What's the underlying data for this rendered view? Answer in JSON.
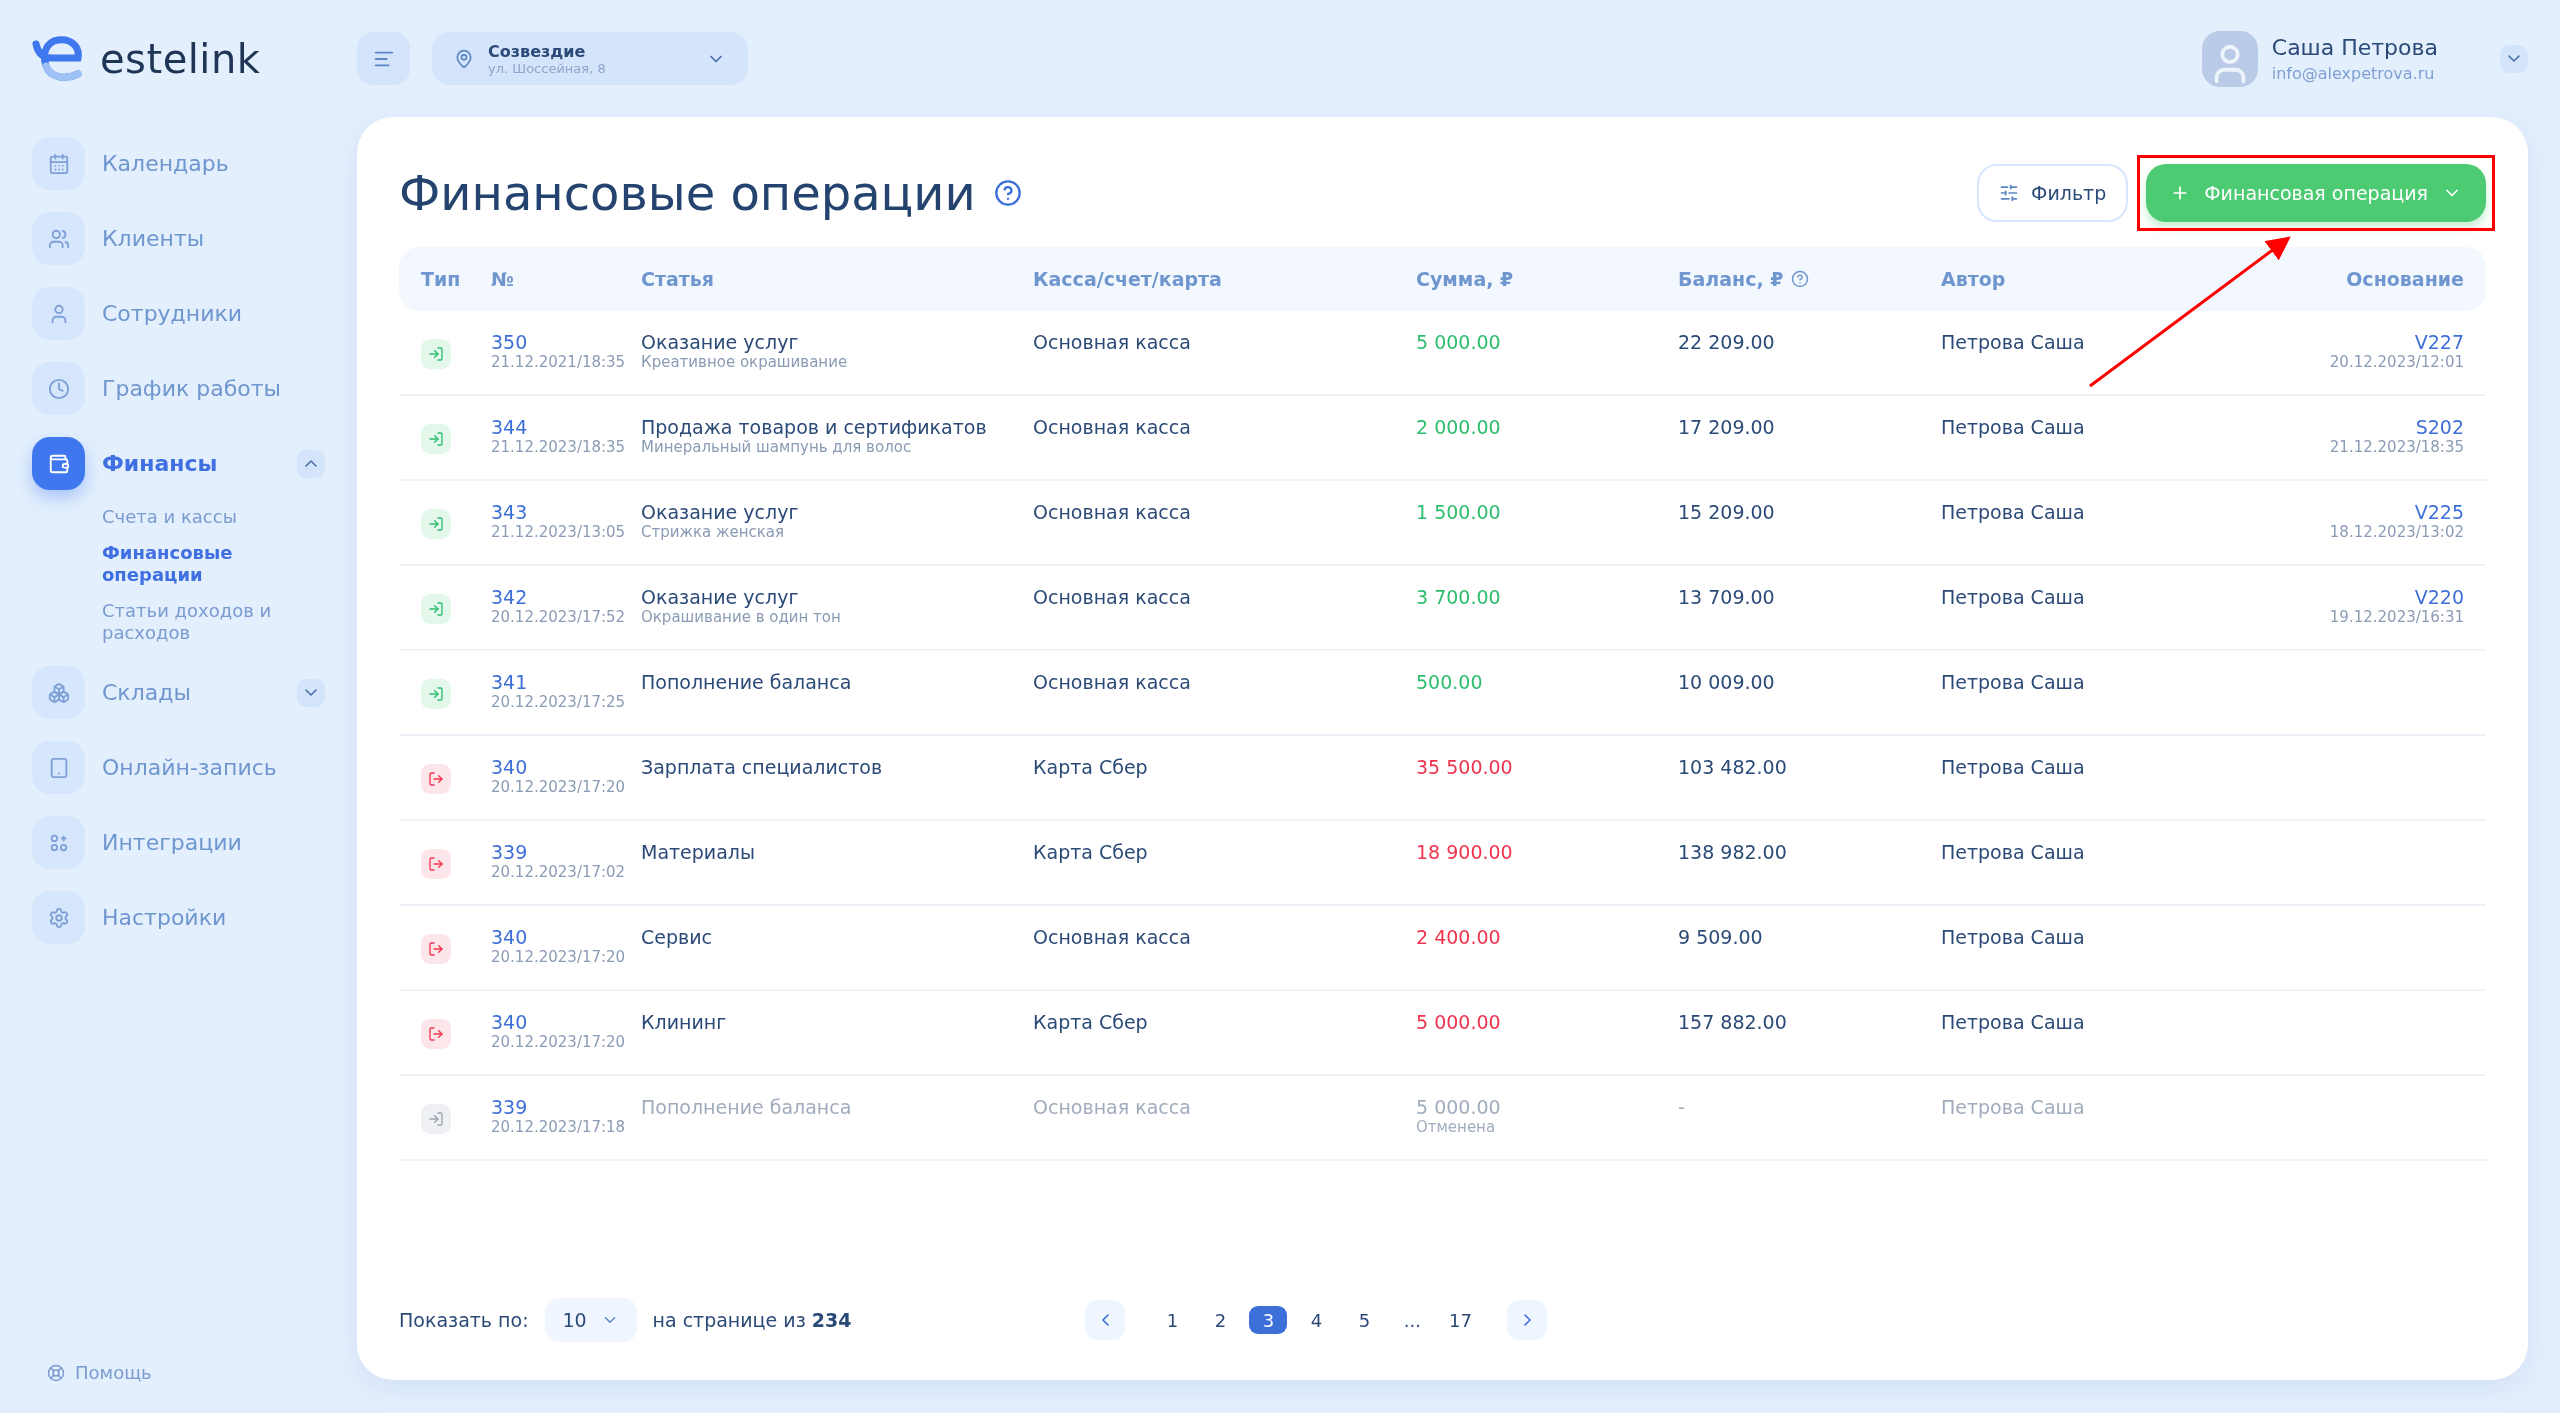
{
  "brand": {
    "name": "estelink"
  },
  "location": {
    "name": "Созвездие",
    "address": "ул. Шоссейная, 8"
  },
  "user": {
    "name": "Саша Петрова",
    "email": "info@alexpetrova.ru"
  },
  "sidebar": {
    "items": [
      {
        "label": "Календарь",
        "selected": false
      },
      {
        "label": "Клиенты",
        "selected": false
      },
      {
        "label": "Сотрудники",
        "selected": false
      },
      {
        "label": "График работы",
        "selected": false
      },
      {
        "label": "Финансы",
        "selected": true,
        "expanded": true,
        "children": [
          {
            "label": "Счета и кассы",
            "selected": false
          },
          {
            "label": "Финансовые операции",
            "selected": true
          },
          {
            "label": "Статьи доходов и расходов",
            "selected": false
          }
        ]
      },
      {
        "label": "Склады",
        "selected": false,
        "expanded": false
      },
      {
        "label": "Онлайн-запись",
        "selected": false
      },
      {
        "label": "Интеграции",
        "selected": false
      },
      {
        "label": "Настройки",
        "selected": false
      }
    ],
    "help": "Помощь"
  },
  "page": {
    "title": "Финансовые операции",
    "filter_button": "Фильтр",
    "add_button": {
      "label": "Финансовая операция",
      "highlighted": true
    }
  },
  "table": {
    "columns": [
      "Тип",
      "№",
      "Статья",
      "Касса/счет/карта",
      "Сумма, ₽",
      "Баланс, ₽",
      "Автор",
      "Основание"
    ],
    "rows": [
      {
        "kind": "income",
        "cancelled": false,
        "number": "350",
        "date": "21.12.2021/18:35",
        "article": "Оказание услуг",
        "detail": "Креативное окрашивание",
        "account": "Основная касса",
        "amount": "5 000.00",
        "balance": "22 209.00",
        "author": "Петрова Саша",
        "basis": "V227",
        "basis_date": "20.12.2023/12:01"
      },
      {
        "kind": "income",
        "cancelled": false,
        "number": "344",
        "date": "21.12.2023/18:35",
        "article": "Продажа товаров и сертификатов",
        "detail": "Минеральный шампунь для волос",
        "account": "Основная касса",
        "amount": "2 000.00",
        "balance": "17 209.00",
        "author": "Петрова Саша",
        "basis": "S202",
        "basis_date": "21.12.2023/18:35"
      },
      {
        "kind": "income",
        "cancelled": false,
        "number": "343",
        "date": "21.12.2023/13:05",
        "article": "Оказание услуг",
        "detail": "Стрижка женская",
        "account": "Основная касса",
        "amount": "1 500.00",
        "balance": "15 209.00",
        "author": "Петрова Саша",
        "basis": "V225",
        "basis_date": "18.12.2023/13:02"
      },
      {
        "kind": "income",
        "cancelled": false,
        "number": "342",
        "date": "20.12.2023/17:52",
        "article": "Оказание услуг",
        "detail": "Окрашивание в один тон",
        "account": "Основная касса",
        "amount": "3 700.00",
        "balance": "13 709.00",
        "author": "Петрова Саша",
        "basis": "V220",
        "basis_date": "19.12.2023/16:31"
      },
      {
        "kind": "income",
        "cancelled": false,
        "number": "341",
        "date": "20.12.2023/17:25",
        "article": "Пополнение баланса",
        "account": "Основная касса",
        "amount": "500.00",
        "balance": "10 009.00",
        "author": "Петрова Саша"
      },
      {
        "kind": "expense",
        "cancelled": false,
        "number": "340",
        "date": "20.12.2023/17:20",
        "article": "Зарплата специалистов",
        "account": "Карта Сбер",
        "amount": "35 500.00",
        "balance": "103 482.00",
        "author": "Петрова Саша"
      },
      {
        "kind": "expense",
        "cancelled": false,
        "number": "339",
        "date": "20.12.2023/17:02",
        "article": "Материалы",
        "account": "Карта Сбер",
        "amount": "18 900.00",
        "balance": "138 982.00",
        "author": "Петрова Саша"
      },
      {
        "kind": "expense",
        "cancelled": false,
        "number": "340",
        "date": "20.12.2023/17:20",
        "article": "Сервис",
        "account": "Основная касса",
        "amount": "2 400.00",
        "balance": "9 509.00",
        "author": "Петрова Саша"
      },
      {
        "kind": "expense",
        "cancelled": false,
        "number": "340",
        "date": "20.12.2023/17:20",
        "article": "Клининг",
        "account": "Карта Сбер",
        "amount": "5 000.00",
        "balance": "157 882.00",
        "author": "Петрова Саша"
      },
      {
        "kind": "income",
        "cancelled": true,
        "status": "Отменена",
        "number": "339",
        "date": "20.12.2023/17:18",
        "article": "Пополнение баланса",
        "account": "Основная касса",
        "amount": "5 000.00",
        "balance": "-",
        "author": "Петрова Саша"
      }
    ]
  },
  "pagination": {
    "show_label": "Показать по:",
    "page_size": "10",
    "summary": "на странице из **234**",
    "pages": [
      {
        "label": "1",
        "selected": false
      },
      {
        "label": "2",
        "selected": false
      },
      {
        "label": "3",
        "selected": true
      },
      {
        "label": "4",
        "selected": false
      },
      {
        "label": "5",
        "selected": false
      },
      {
        "label": "...",
        "selected": false
      },
      {
        "label": "17",
        "selected": false
      }
    ]
  }
}
